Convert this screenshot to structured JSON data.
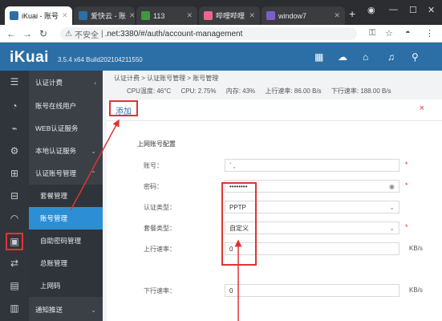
{
  "browser": {
    "tabs": [
      {
        "label": "iKuai - 账号",
        "active": true,
        "color": "#2c6fa6"
      },
      {
        "label": "爱快云 - 账",
        "active": false,
        "color": "#2c6fa6"
      },
      {
        "label": "113",
        "active": false,
        "color": "#3d9a3d"
      },
      {
        "label": "哔哩哔哩",
        "active": false,
        "color": "#e8688d"
      },
      {
        "label": "window7",
        "active": false,
        "color": "#7b5fc7"
      }
    ],
    "url_warning": "不安全",
    "url_host": "|",
    "url_path": ".net:3380/#/auth/account-management"
  },
  "header": {
    "logo": "iKuai",
    "version": "3.5.4 x64 Build202104211550"
  },
  "sidebar": {
    "items": [
      {
        "label": "认证计费",
        "caret": "‹"
      },
      {
        "label": "账号在线用户"
      },
      {
        "label": "WEB认证服务"
      },
      {
        "label": "本地认证服务",
        "caret": "⌄"
      },
      {
        "label": "认证账号管理",
        "caret": "⌃"
      },
      {
        "label": "套餐管理"
      },
      {
        "label": "账号管理"
      },
      {
        "label": "自助密码管理"
      },
      {
        "label": "总账管理"
      },
      {
        "label": "上网码"
      },
      {
        "label": "通知推送",
        "caret": "⌄"
      }
    ]
  },
  "main": {
    "breadcrumb": "认证计费 > 认证账号管理 > 账号管理",
    "stats": {
      "cpu_temp": "CPU温度: 46°C",
      "cpu": "CPU: 2.75%",
      "mem": "内存: 43%",
      "up": "上行速率: 86.00 B/s",
      "down": "下行速率: 188.00 B/s"
    },
    "dialog_title": "添加",
    "close": "×",
    "section_title": "上网账号配置",
    "fields": {
      "account_label": "账号：",
      "account_value": "` ,",
      "password_label": "密码：",
      "password_value": "••••••••",
      "auth_type_label": "认证类型：",
      "auth_type_value": "PPTP",
      "package_label": "套餐类型：",
      "package_value": "自定义",
      "up_label": "上行速率：",
      "up_value": "0",
      "down_label": "下行速率：",
      "down_value": "0",
      "unit": "KB/s",
      "required": "*"
    }
  }
}
